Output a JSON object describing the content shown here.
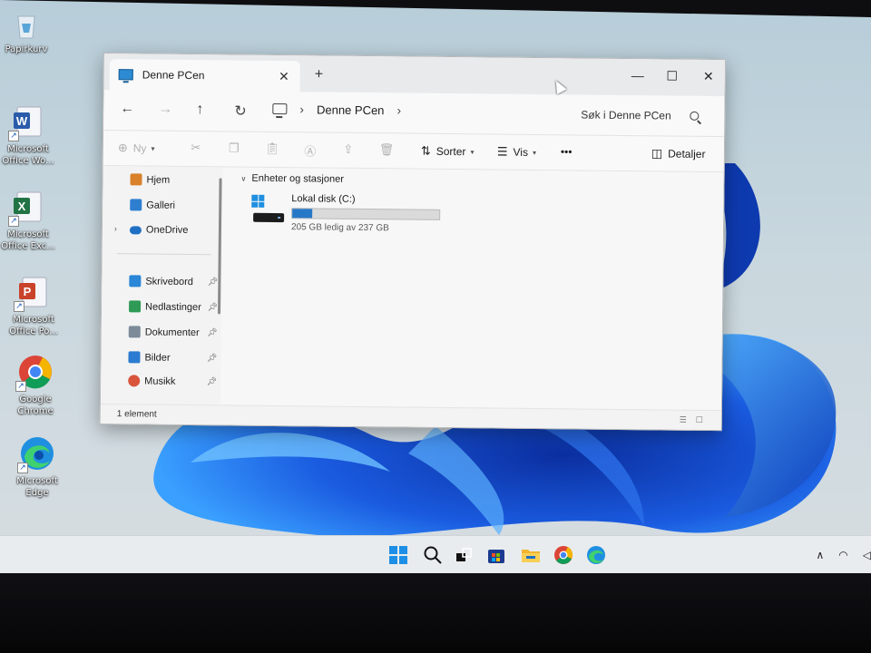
{
  "desktop": {
    "icons": [
      {
        "label": "Papirkurv",
        "icon": "recycle-bin-icon"
      },
      {
        "label": "Microsoft Office Wo...",
        "icon": "word-icon"
      },
      {
        "label": "Microsoft Office Exc...",
        "icon": "excel-icon"
      },
      {
        "label": "Microsoft Office Po...",
        "icon": "powerpoint-icon"
      },
      {
        "label": "Google Chrome",
        "icon": "chrome-icon"
      },
      {
        "label": "Microsoft Edge",
        "icon": "edge-icon"
      }
    ]
  },
  "explorer": {
    "tab_title": "Denne PCen",
    "new_tab": "+",
    "breadcrumb": [
      "Denne PCen"
    ],
    "search_placeholder": "Søk i Denne PCen",
    "toolbar": {
      "new_label": "Ny",
      "sort_label": "Sorter",
      "view_label": "Vis",
      "more_label": "•••",
      "details_label": "Detaljer"
    },
    "nav": {
      "items_top": [
        {
          "label": "Hjem",
          "icon": "home-icon",
          "color": "#d9822b"
        },
        {
          "label": "Galleri",
          "icon": "gallery-icon",
          "color": "#2f7fd1"
        },
        {
          "label": "OneDrive",
          "icon": "cloud-icon",
          "color": "#1f6fc4"
        }
      ],
      "items_pinned": [
        {
          "label": "Skrivebord",
          "icon": "desktop-icon",
          "color": "#2a86d6"
        },
        {
          "label": "Nedlastinger",
          "icon": "download-icon",
          "color": "#2e9a56"
        },
        {
          "label": "Dokumenter",
          "icon": "documents-icon",
          "color": "#7c8a99"
        },
        {
          "label": "Bilder",
          "icon": "pictures-icon",
          "color": "#2b7bd0"
        },
        {
          "label": "Musikk",
          "icon": "music-icon",
          "color": "#d8553c"
        }
      ]
    },
    "group_header": "Enheter og stasjoner",
    "drive": {
      "name": "Lokal disk (C:)",
      "free_text": "205 GB ledig av 237 GB",
      "used_fraction": 0.135
    },
    "status": "1 element"
  },
  "colors": {
    "accent": "#2878c8",
    "bloom_dark": "#0a2f8f",
    "bloom_light": "#3aa0ff"
  }
}
